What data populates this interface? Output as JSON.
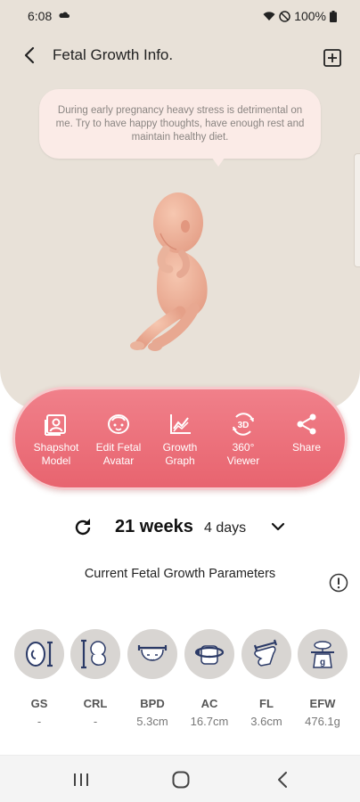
{
  "status_bar": {
    "time": "6:08",
    "battery": "100%"
  },
  "header": {
    "title": "Fetal Growth Info."
  },
  "bubble": {
    "text": "During early pregnancy heavy stress is detrimental on me. Try to have happy thoughts, have enough rest and maintain healthy diet."
  },
  "toolbar": {
    "items": [
      {
        "line1": "Shapshot",
        "line2": "Model",
        "icon": "snapshot-icon"
      },
      {
        "line1": "Edit Fetal",
        "line2": "Avatar",
        "icon": "avatar-face-icon"
      },
      {
        "line1": "Growth",
        "line2": "Graph",
        "icon": "graph-icon"
      },
      {
        "line1": "360°",
        "line2": "Viewer",
        "icon": "3d-icon",
        "icon_text": "3D"
      },
      {
        "line1": "Share",
        "line2": "",
        "icon": "share-icon"
      }
    ]
  },
  "week": {
    "weeks": "21 weeks",
    "days": "4 days"
  },
  "params": {
    "title": "Current Fetal Growth Parameters",
    "items": [
      {
        "label": "GS",
        "value": "-"
      },
      {
        "label": "CRL",
        "value": "-"
      },
      {
        "label": "BPD",
        "value": "5.3cm"
      },
      {
        "label": "AC",
        "value": "16.7cm"
      },
      {
        "label": "FL",
        "value": "3.6cm"
      },
      {
        "label": "EFW",
        "value": "476.1g",
        "icon_text": "g"
      }
    ]
  },
  "colors": {
    "accent": "#e8646f",
    "hero_bg": "#e8e1d8",
    "bubble_bg": "#fbebe7",
    "param_circle": "#d8d5d2",
    "icon_dark": "#2b3a67"
  }
}
